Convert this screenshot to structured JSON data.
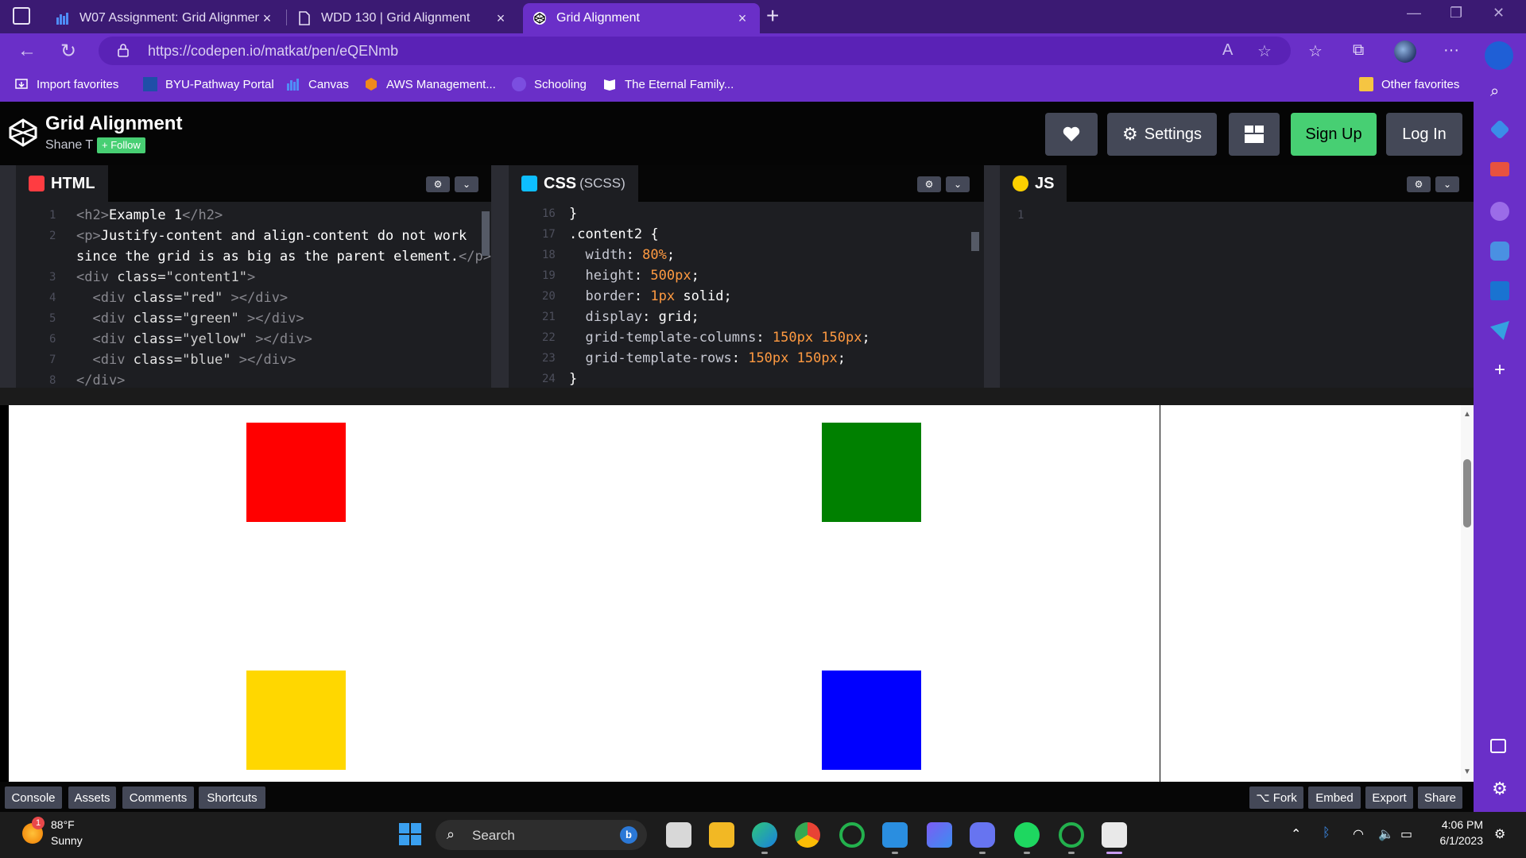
{
  "browser": {
    "tabs": [
      {
        "title": "W07 Assignment: Grid Alignmen",
        "icon": "canvas-icon",
        "active": false
      },
      {
        "title": "WDD 130 | Grid Alignment",
        "icon": "document-icon",
        "active": false
      },
      {
        "title": "Grid Alignment",
        "icon": "codepen-icon",
        "active": true
      }
    ],
    "new_tab": "+",
    "url": "https://codepen.io/matkat/pen/eQENmb",
    "menu_glyph": "···",
    "favorites": [
      {
        "label": "Import favorites",
        "icon": "import-icon"
      },
      {
        "label": "BYU-Pathway Portal",
        "icon": "byu-icon"
      },
      {
        "label": "Canvas",
        "icon": "canvas-icon"
      },
      {
        "label": "AWS Management...",
        "icon": "aws-icon"
      },
      {
        "label": "Schooling",
        "icon": "schooling-icon"
      },
      {
        "label": "The Eternal Family...",
        "icon": "book-icon"
      }
    ],
    "other_favorites": "Other favorites"
  },
  "codepen": {
    "title": "Grid Alignment",
    "author": "Shane T",
    "follow": "+ Follow",
    "buttons": {
      "settings": "Settings",
      "sign_up": "Sign Up",
      "log_in": "Log In"
    },
    "panes": {
      "html": {
        "label": "HTML"
      },
      "css": {
        "label": "CSS",
        "sub": "(SCSS)"
      },
      "js": {
        "label": "JS",
        "line": "1"
      }
    },
    "footer": {
      "left": [
        "Console",
        "Assets",
        "Comments",
        "Shortcuts"
      ],
      "right": [
        "⌥ Fork",
        "Embed",
        "Export",
        "Share"
      ]
    }
  },
  "preview": {
    "boxes": [
      {
        "name": "red",
        "color": "#ff0000"
      },
      {
        "name": "green",
        "color": "#008000"
      },
      {
        "name": "yellow",
        "color": "#ffd700"
      },
      {
        "name": "blue",
        "color": "#0000ff"
      }
    ]
  },
  "taskbar": {
    "weather_temp": "88°F",
    "weather_cond": "Sunny",
    "weather_badge": "1",
    "search": "Search",
    "time": "4:06 PM",
    "date": "6/1/2023"
  },
  "colors": {
    "edge_purple": "#6a2fc8",
    "tabstrip_purple": "#3b1a73",
    "codepen_green": "#47cf73",
    "codepen_gray": "#444857"
  }
}
